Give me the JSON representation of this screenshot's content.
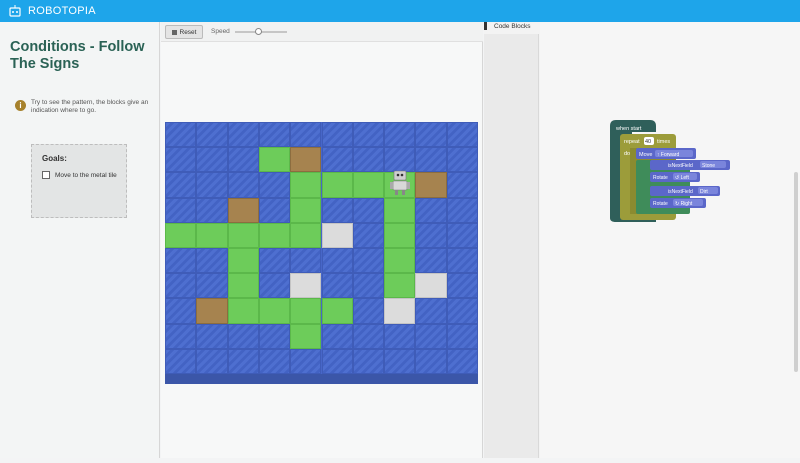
{
  "app": {
    "title": "ROBOTOPIA",
    "logo_icon": "robot-icon"
  },
  "lesson": {
    "title": "Conditions - Follow The Signs",
    "hint": "Try to see the pattern, the blocks give an indication where to go.",
    "hint_icon": "info-icon"
  },
  "goals": {
    "title": "Goals:",
    "items": [
      {
        "label": "Move to the metal tile",
        "checked": false
      }
    ]
  },
  "toolbar": {
    "reset_label": "Reset",
    "speed_label": "Speed",
    "speed_value": 0.45
  },
  "grid": {
    "cols": 10,
    "rows": 10,
    "rows_data": [
      "wwwwwwwwww",
      "wwwGDwwwww",
      "wwwwGGGGDw",
      "wwDwGwwGww",
      "GGGGGMwGww",
      "wwGwwwwGww",
      "wwGwMwwGMw",
      "wDGGGGwMww",
      "wwwwGwwwww",
      "wwwwwwwwww"
    ],
    "legend": {
      "w": "water",
      "G": "grass",
      "D": "dirt",
      "M": "metal"
    },
    "robot_cell": [
      7,
      2
    ]
  },
  "code": {
    "title": "Code Blocks",
    "blocks": {
      "start": "when start",
      "repeat": "repeat",
      "repeat_count": "40",
      "times": "times",
      "do": "do",
      "move": "Move",
      "move_dir": "↑ Forward",
      "if1_cond": "isNextField",
      "if1_val": "Stone",
      "rotate": "Rotate",
      "rotate1_val": "↺ Left",
      "if2_cond": "isNextField",
      "if2_val": "Dirt",
      "rotate2_val": "↻ Right"
    },
    "colors": {
      "start": "#2f5f5a",
      "repeat": "#9c9c3a",
      "move": "#5b67c9",
      "if": "#3f8c5a",
      "rotate": "#5b67c9"
    }
  }
}
